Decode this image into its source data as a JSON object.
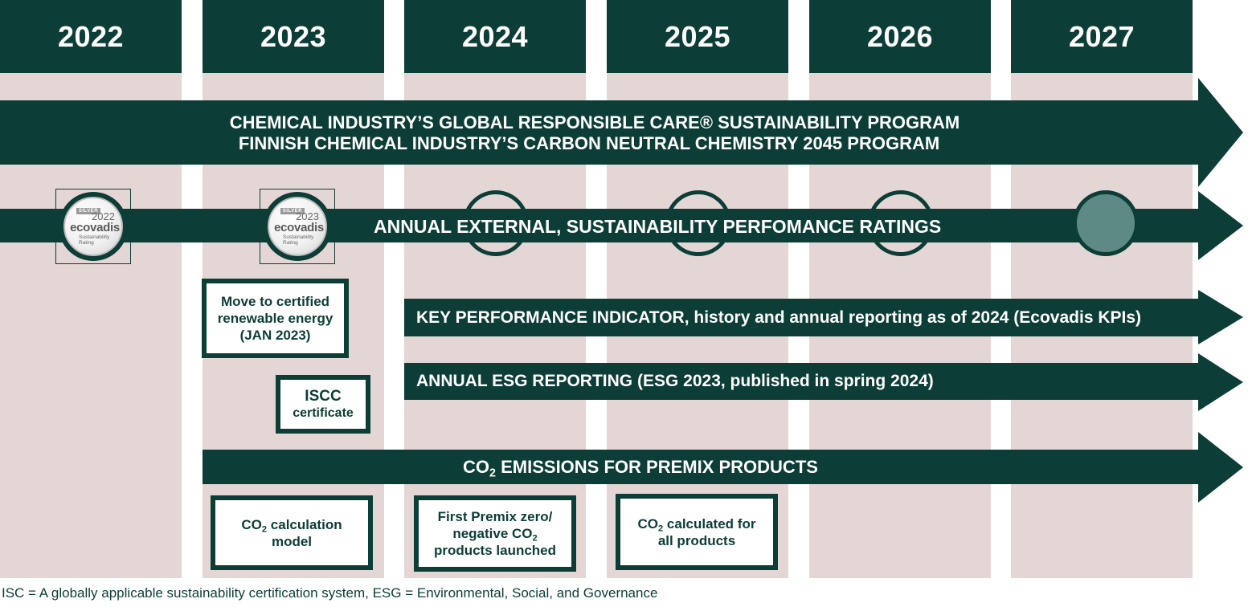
{
  "years": [
    "2022",
    "2023",
    "2024",
    "2025",
    "2026",
    "2027"
  ],
  "programs": {
    "line1": "CHEMICAL INDUSTRY’S GLOBAL RESPONSIBLE CARE® SUSTAINABILITY PROGRAM",
    "line2": "FINNISH CHEMICAL INDUSTRY’S CARBON NEUTRAL CHEMISTRY 2045 PROGRAM"
  },
  "ratings": {
    "label": "ANNUAL EXTERNAL, SUSTAINABILITY PERFOMANCE RATINGS",
    "badges": [
      {
        "level": "SILVER",
        "year": "2022",
        "brand": "ecovadis",
        "sub1": "Sustainability",
        "sub2": "Rating"
      },
      {
        "level": "SILVER",
        "year": "2023",
        "brand": "ecovadis",
        "sub1": "Sustainability",
        "sub2": "Rating"
      }
    ]
  },
  "kpi": {
    "bold": "KEY PERFORMANCE INDICATOR,",
    "rest": " history and annual reporting as of 2024 (Ecovadis KPIs)"
  },
  "esg": {
    "bold": "ANNUAL ESG REPORTING",
    "rest": " (ESG 2023, published in spring 2024)"
  },
  "co2_band": {
    "pre": "CO",
    "sub": "2",
    "post": " EMISSIONS FOR PREMIX PRODUCTS"
  },
  "boxes": {
    "renewable": {
      "line1": "Move to certified",
      "line2": "renewable energy",
      "line3": "(JAN 2023)"
    },
    "iscc": {
      "line1": "ISCC",
      "line2": "certificate"
    },
    "co2_model": {
      "pre": "CO",
      "sub": "2",
      "post": " calculation",
      "line2": "model"
    },
    "first_premix": {
      "line1": "First Premix zero/",
      "line2_pre": "negative CO",
      "line2_sub": "2",
      "line3": "products launched"
    },
    "co2_all": {
      "pre": "CO",
      "sub": "2",
      "post": " calculated for",
      "line2": "all products"
    }
  },
  "footnote": "ISC = A globally applicable sustainability certification system, ESG = Environmental, Social, and Governance",
  "colors": {
    "dark_green": "#0c3d36",
    "column_bg": "#e4d6d4",
    "teal_fill": "#5e8a86"
  }
}
